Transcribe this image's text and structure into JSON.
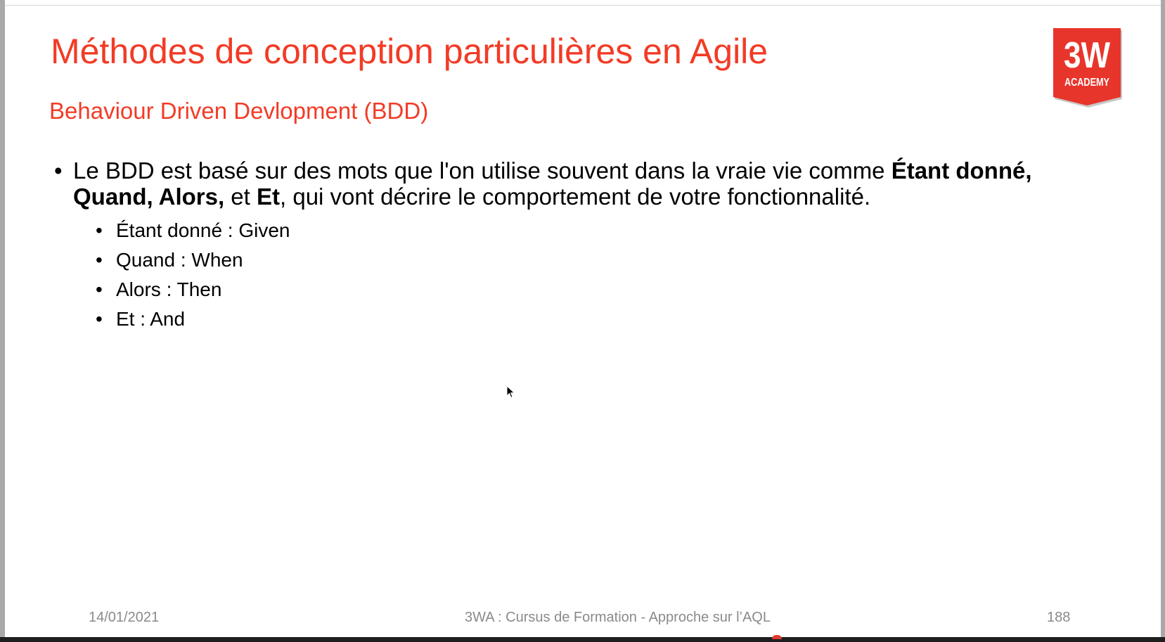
{
  "slide": {
    "title": "Méthodes de conception particulières en Agile",
    "subtitle": "Behaviour Driven Devlopment (BDD)",
    "logo": {
      "line1": "3W",
      "line2": "ACADEMY",
      "color": "#e8352b"
    },
    "bullet": {
      "part1": "Le BDD est basé sur des mots que l'on utilise souvent dans la vraie vie comme ",
      "bold1": "Étant donné, Quand, Alors,",
      "part2": " et ",
      "bold2": "Et",
      "part3": ", qui vont décrire le comportement de votre fonctionnalité."
    },
    "sub_items": [
      "Étant donné : Given",
      "Quand : When",
      "Alors : Then",
      "Et : And"
    ],
    "bullet_glyph": "•",
    "accent_color": "#f23b26"
  },
  "footer": {
    "date": "14/01/2021",
    "center": "3WA : Cursus de Formation - Approche sur l’AQL",
    "page": "188"
  }
}
